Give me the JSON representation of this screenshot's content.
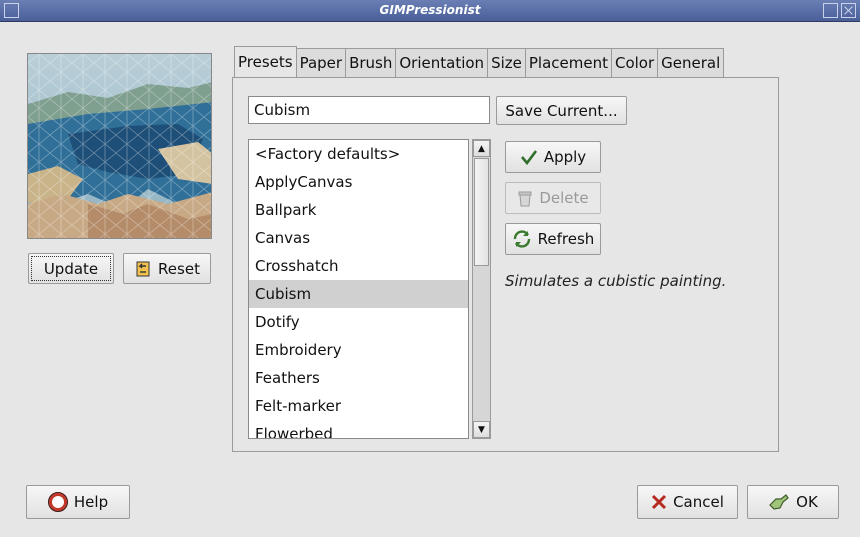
{
  "window": {
    "title": "GIMPressionist"
  },
  "left": {
    "update_label": "Update",
    "reset_label": "Reset"
  },
  "tabs": [
    {
      "label": "Presets",
      "active": true
    },
    {
      "label": "Paper"
    },
    {
      "label": "Brush"
    },
    {
      "label": "Orientation"
    },
    {
      "label": "Size"
    },
    {
      "label": "Placement"
    },
    {
      "label": "Color"
    },
    {
      "label": "General"
    }
  ],
  "presets": {
    "name_value": "Cubism",
    "save_label": "Save Current...",
    "apply_label": "Apply",
    "delete_label": "Delete",
    "refresh_label": "Refresh",
    "description": "Simulates a cubistic painting.",
    "items": [
      "<Factory defaults>",
      "ApplyCanvas",
      "Ballpark",
      "Canvas",
      "Crosshatch",
      "Cubism",
      "Dotify",
      "Embroidery",
      "Feathers",
      "Felt-marker",
      "Flowerbed"
    ],
    "selected": "Cubism"
  },
  "footer": {
    "help_label": "Help",
    "cancel_label": "Cancel",
    "ok_label": "OK"
  },
  "colors": {
    "titlebar": "#5a6fa8",
    "selection": "#d0d0d0"
  }
}
